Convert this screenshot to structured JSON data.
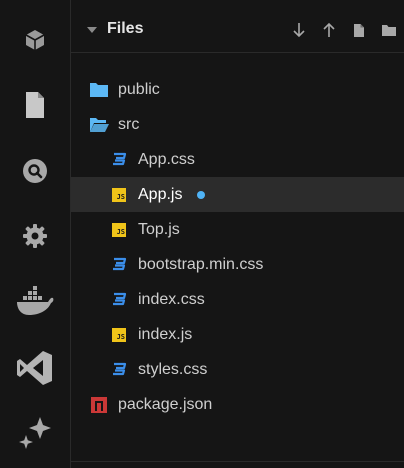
{
  "activity_bar": {
    "icons": [
      "box-icon",
      "file-icon",
      "search-icon",
      "gear-icon",
      "docker-icon",
      "vscode-icon",
      "sparkle-icon"
    ]
  },
  "explorer": {
    "title": "Files",
    "actions": [
      "download-icon",
      "upload-icon",
      "new-file-icon",
      "new-folder-icon"
    ],
    "items": [
      {
        "label": "public",
        "type": "folder",
        "level": 0
      },
      {
        "label": "src",
        "type": "folder-open",
        "level": 0
      },
      {
        "label": "App.css",
        "type": "css",
        "level": 1
      },
      {
        "label": "App.js",
        "type": "js",
        "level": 1,
        "active": true,
        "modified": true
      },
      {
        "label": "Top.js",
        "type": "js",
        "level": 1
      },
      {
        "label": "bootstrap.min.css",
        "type": "css",
        "level": 1
      },
      {
        "label": "index.css",
        "type": "css",
        "level": 1
      },
      {
        "label": "index.js",
        "type": "js",
        "level": 1
      },
      {
        "label": "styles.css",
        "type": "css",
        "level": 1
      },
      {
        "label": "package.json",
        "type": "npm",
        "level": 0
      }
    ]
  },
  "colors": {
    "accent": "#4fb3f6",
    "folder": "#5cb8f5",
    "js": "#f0c419",
    "css": "#3b8eea",
    "npm": "#cb3837"
  }
}
